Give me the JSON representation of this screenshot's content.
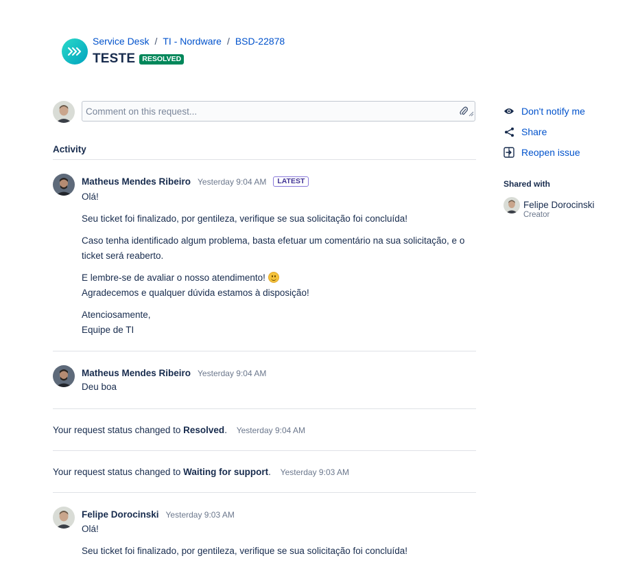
{
  "breadcrumb": {
    "service_desk": "Service Desk",
    "project": "TI - Nordware",
    "issue_key": "BSD-22878",
    "separator": "/"
  },
  "request": {
    "title": "TESTE",
    "status_lozenge": "RESOLVED"
  },
  "comment_box": {
    "placeholder": "Comment on this request..."
  },
  "activity": {
    "heading": "Activity",
    "entries": [
      {
        "author": "Matheus Mendes Ribeiro",
        "time": "Yesterday 9:04 AM",
        "badge": "LATEST",
        "lines": [
          "Olá!",
          "Seu ticket foi finalizado, por gentileza, verifique se sua solicitação foi concluída!",
          "Caso tenha identificado algum problema, basta efetuar um comentário na sua solicitação, e o ticket será reaberto.",
          "E lembre-se de avaliar o nosso atendimento!",
          "Agradecemos e qualquer dúvida estamos à disposição!",
          "Atenciosamente,",
          "Equipe de TI"
        ]
      },
      {
        "author": "Matheus Mendes Ribeiro",
        "time": "Yesterday 9:04 AM",
        "lines": [
          "Deu boa"
        ]
      },
      {
        "prefix": "Your request status changed to",
        "status": "Resolved",
        "suffix": ".",
        "time": "Yesterday 9:04 AM"
      },
      {
        "prefix": "Your request status changed to",
        "status": "Waiting for support",
        "suffix": ".",
        "time": "Yesterday 9:03 AM"
      },
      {
        "author": "Felipe Dorocinski",
        "time": "Yesterday 9:03 AM",
        "lines": [
          "Olá!",
          "Seu ticket foi finalizado, por gentileza, verifique se sua solicitação foi concluída!"
        ]
      }
    ]
  },
  "sidebar": {
    "actions": [
      "Don't notify me",
      "Share",
      "Reopen issue"
    ],
    "shared_with_heading": "Shared with",
    "shared_users": [
      {
        "name": "Felipe Dorocinski",
        "role": "Creator"
      }
    ]
  },
  "colors": {
    "link": "#0052cc",
    "text": "#172b4d",
    "resolved": "#00875a",
    "latest_border": "#8777d9",
    "logo": "#00b8d9"
  },
  "icons": [
    "service-desk-logo-icon",
    "paperclip-icon",
    "eye-icon",
    "share-icon",
    "reopen-icon",
    "smile-emoji-icon"
  ]
}
